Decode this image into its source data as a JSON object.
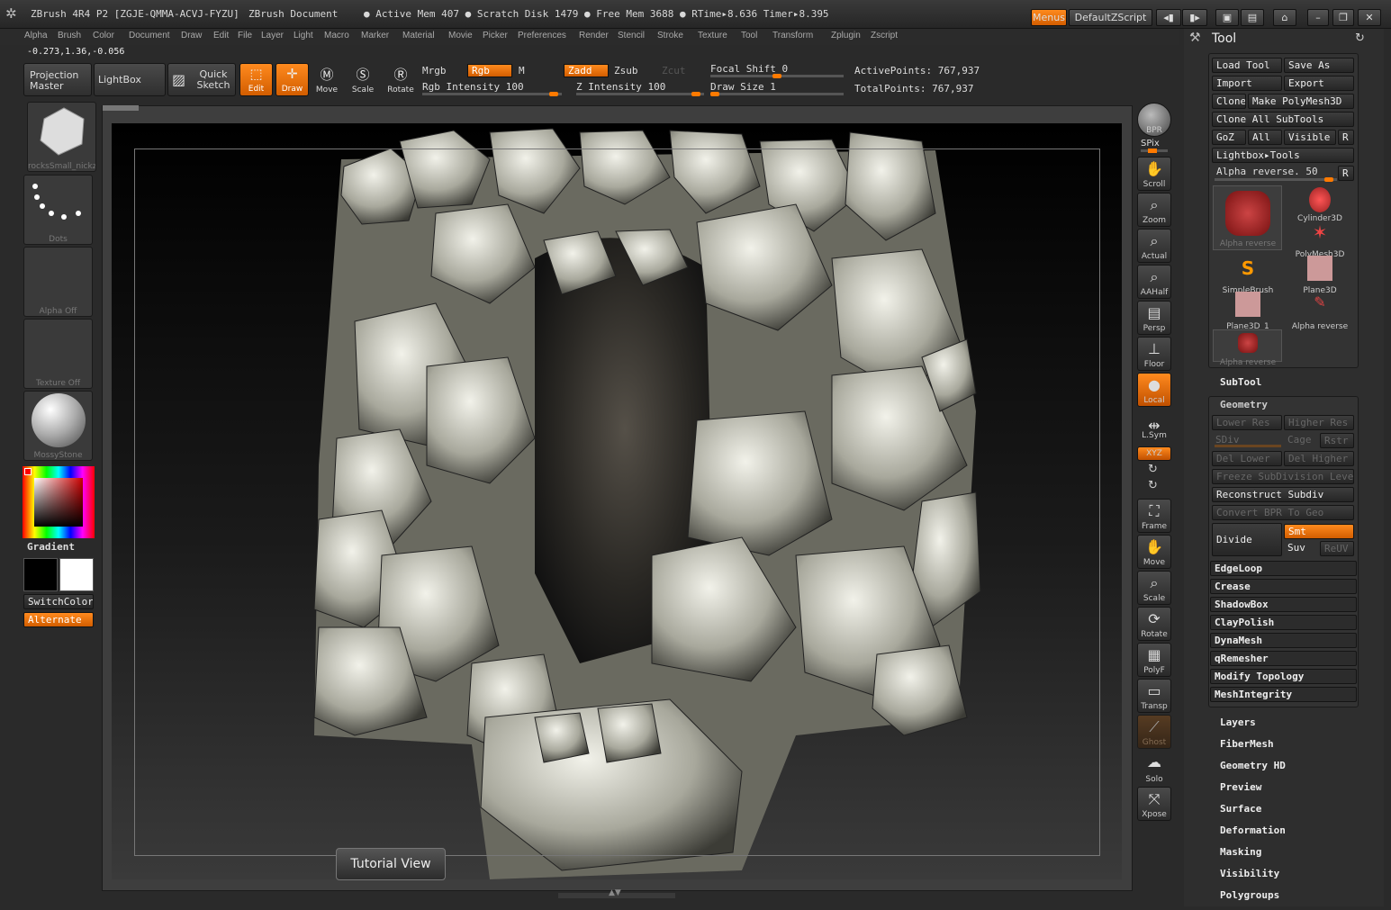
{
  "title": {
    "app": "ZBrush 4R4 P2 [ZGJE-QMMA-ACVJ-FYZU]",
    "doc": "ZBrush Document",
    "mem": "● Active Mem 407 ● Scratch Disk 1479 ● Free Mem 3688 ● RTime▸8.636 Timer▸8.395",
    "menus_btn": "Menus",
    "script_btn": "DefaultZScript"
  },
  "menubar": [
    "Alpha",
    "Brush",
    "Color",
    "Document",
    "Draw",
    "Edit",
    "File",
    "Layer",
    "Light",
    "Macro",
    "Marker",
    "Material",
    "Movie",
    "Picker",
    "Preferences",
    "Render",
    "Stencil",
    "Stroke",
    "Texture",
    "Tool",
    "Transform",
    "Zplugin",
    "Zscript"
  ],
  "coords": "-0.273,1.36,-0.056",
  "toolbar": {
    "projection_master": "Projection Master",
    "lightbox": "LightBox",
    "quick_sketch": "Quick Sketch",
    "edit": "Edit",
    "draw": "Draw",
    "move": "Move",
    "scale": "Scale",
    "rotate": "Rotate",
    "mrgb": "Mrgb",
    "rgb": "Rgb",
    "m": "M",
    "zadd": "Zadd",
    "zsub": "Zsub",
    "zcut": "Zcut",
    "rgb_intensity": "Rgb Intensity 100",
    "z_intensity": "Z Intensity 100",
    "focal_shift": "Focal Shift 0",
    "draw_size": "Draw Size 1",
    "active_points": "ActivePoints: 767,937",
    "total_points": "TotalPoints: 767,937",
    "rgb_intensity_value": 100,
    "z_intensity_value": 100,
    "focal_shift_value": 0,
    "draw_size_value": 1
  },
  "left": {
    "thumbs": [
      "rocksSmall_nickz",
      "Dots",
      "Alpha Off",
      "Texture Off",
      "MossyStone"
    ],
    "gradient": "Gradient",
    "switchcolor": "SwitchColor",
    "alternate": "Alternate"
  },
  "tutorial": "Tutorial View",
  "righttools": [
    "BPR",
    "SPix",
    "Scroll",
    "Zoom",
    "Actual",
    "AAHalf",
    "Persp",
    "Floor",
    "Local",
    "L.Sym",
    "XYZ",
    "Frame",
    "Move",
    "Scale",
    "Rotate",
    "PolyF",
    "Transp",
    "Ghost",
    "Solo",
    "Xpose"
  ],
  "tool": {
    "header": "Tool",
    "buttons": [
      "Load Tool",
      "Save As",
      "Import",
      "Export",
      "Clone",
      "Make PolyMesh3D",
      "Clone All SubTools",
      "GoZ",
      "All",
      "Visible",
      "R",
      "Lightbox▸Tools",
      "Alpha reverse. 50",
      "R"
    ],
    "items": [
      "Alpha reverse",
      "Cylinder3D",
      "PolyMesh3D",
      "SimpleBrush",
      "Plane3D",
      "Plane3D_1",
      "Alpha reverse",
      "Alpha reverse"
    ],
    "subtool": "SubTool",
    "geometry": "Geometry",
    "geo_buttons": [
      "Lower Res",
      "Higher Res",
      "SDiv",
      "Cage",
      "Rstr",
      "Del Lower",
      "Del Higher",
      "Freeze SubDivision Levels",
      "Reconstruct Subdiv",
      "Convert BPR To Geo",
      "Divide",
      "Smt",
      "Suv",
      "ReUV"
    ],
    "geo_sections": [
      "EdgeLoop",
      "Crease",
      "ShadowBox",
      "ClayPolish",
      "DynaMesh",
      "qRemesher",
      "Modify Topology",
      "MeshIntegrity"
    ],
    "sections": [
      "Layers",
      "FiberMesh",
      "Geometry HD",
      "Preview",
      "Surface",
      "Deformation",
      "Masking",
      "Visibility",
      "Polygroups"
    ]
  }
}
